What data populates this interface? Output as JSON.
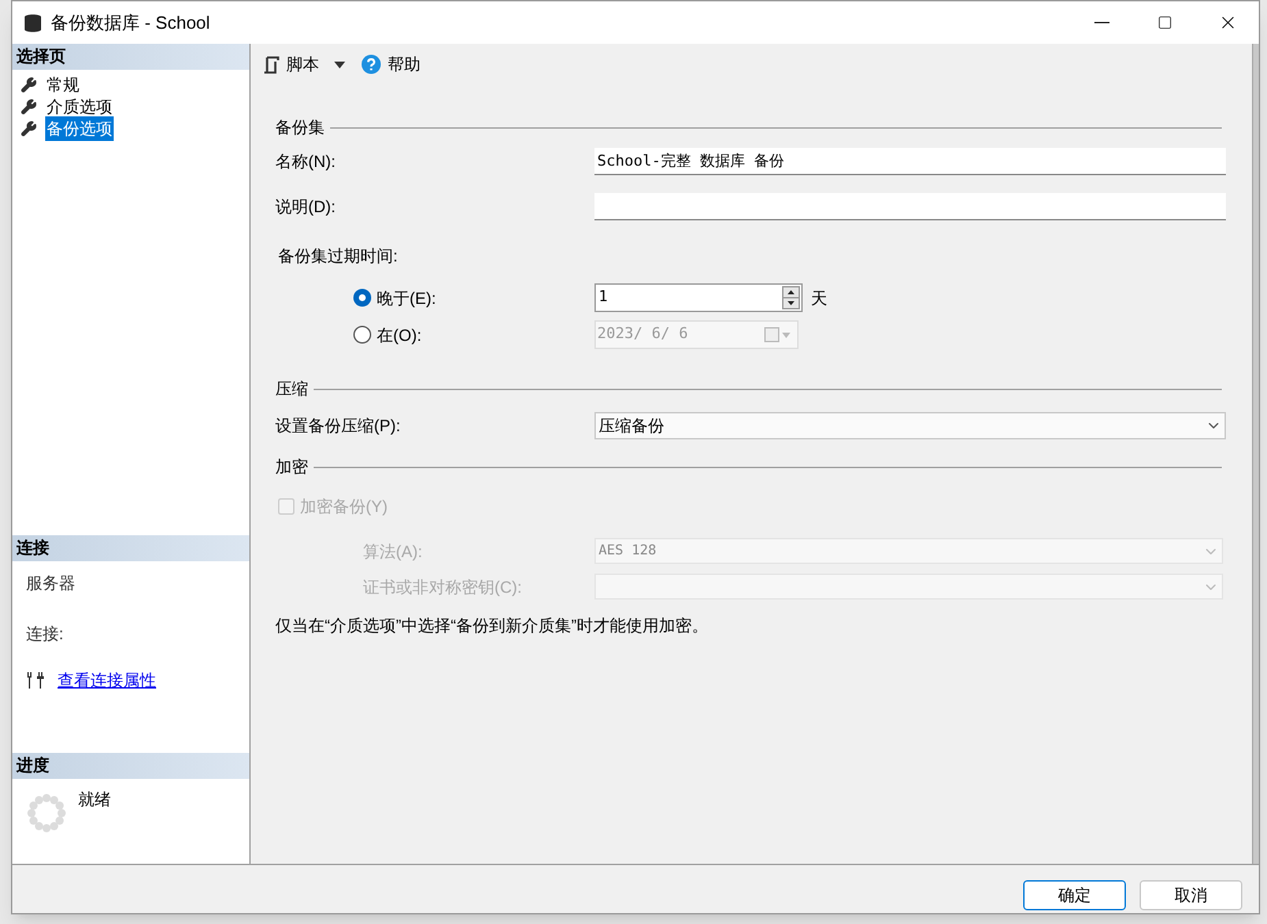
{
  "window": {
    "title": "备份数据库 - School"
  },
  "sidebar": {
    "header": "选择页",
    "items": [
      {
        "label": "常规",
        "selected": false
      },
      {
        "label": "介质选项",
        "selected": false
      },
      {
        "label": "备份选项",
        "selected": true
      }
    ]
  },
  "connection": {
    "header": "连接",
    "fields": [
      "服务器",
      "连接:"
    ],
    "link": "查看连接属性"
  },
  "progress": {
    "header": "进度",
    "status": "就绪"
  },
  "toolbar": {
    "script": "脚本",
    "help": "帮助"
  },
  "backup_set": {
    "heading": "备份集",
    "name_label": "名称(N):",
    "name_value": "School-完整 数据库 备份",
    "description_label": "说明(D):",
    "expiry_label": "备份集过期时间:",
    "expiry_options": [
      {
        "kind": "spinner",
        "label": "晚于(E):",
        "selected": true,
        "value": "1",
        "unit": "天"
      },
      {
        "kind": "date",
        "label": "在(O):",
        "selected": false,
        "value": "2023/ 6/ 6"
      }
    ]
  },
  "compression": {
    "heading": "压缩",
    "label": "设置备份压缩(P):",
    "value": "压缩备份"
  },
  "encryption": {
    "heading": "加密",
    "checkbox": {
      "label": "加密备份(Y)",
      "checked": false,
      "disabled": true
    },
    "algorithm_label": "算法(A):",
    "algorithm_value": "AES 128",
    "key_label": "证书或非对称密钥(C):",
    "note": "仅当在“介质选项”中选择“备份到新介质集”时才能使用加密。"
  },
  "buttons": [
    {
      "label": "确定",
      "default": true
    },
    {
      "label": "取消",
      "default": false
    }
  ]
}
